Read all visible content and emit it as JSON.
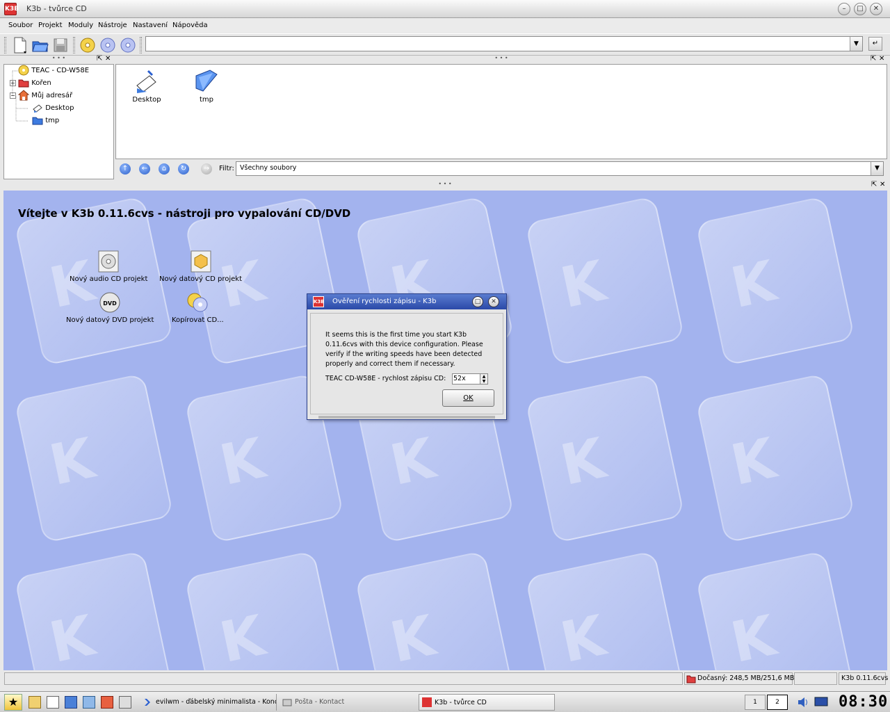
{
  "window": {
    "title": "K3b - tvůrce CD",
    "logo": "K3B"
  },
  "menu": [
    {
      "label": "Soubor"
    },
    {
      "label": "Projekt"
    },
    {
      "label": "Moduly"
    },
    {
      "label": "Nástroje"
    },
    {
      "label": "Nastavení"
    },
    {
      "label": "Nápověda"
    }
  ],
  "toolbar": {
    "url_value": ""
  },
  "tree": {
    "items": [
      {
        "label": "TEAC - CD-W58E",
        "icon": "cd-drive-icon"
      },
      {
        "label": "Kořen",
        "icon": "folder-red-icon"
      },
      {
        "label": "Můj adresář",
        "icon": "home-icon"
      },
      {
        "label": "Desktop",
        "icon": "desktop-icon"
      },
      {
        "label": "tmp",
        "icon": "folder-blue-icon"
      }
    ]
  },
  "files": {
    "items": [
      {
        "label": "Desktop"
      },
      {
        "label": "tmp"
      }
    ]
  },
  "filter": {
    "label": "Filtr:",
    "value": "Všechny soubory"
  },
  "welcome": {
    "title": "Vítejte v K3b 0.11.6cvs - nástroji pro vypalování CD/DVD",
    "actions": [
      {
        "label": "Nový audio CD projekt"
      },
      {
        "label": "Nový datový CD projekt"
      },
      {
        "label": "Nový datový DVD projekt"
      },
      {
        "label": "Kopírovat CD..."
      }
    ],
    "dvd_icon_text": "DVD"
  },
  "dialog": {
    "title": "Ověření rychlosti zápisu - K3b",
    "message": "It seems this is the first time you start K3b 0.11.6cvs with this device configuration. Please verify if the writing speeds have been detected properly and correct them if necessary.",
    "speed_label": "TEAC CD-W58E - rychlost zápisu CD:",
    "speed_value": "52x",
    "ok_label": "OK"
  },
  "status": {
    "temp": "Dočasný: 248,5 MB/251,6 MB",
    "version": "K3b 0.11.6cvs"
  },
  "taskbar": {
    "tasks": [
      {
        "label": "evilwm - ďábelský minimalista - Konq"
      },
      {
        "label": "Pošta - Kontact"
      },
      {
        "label": "K3b - tvůrce CD"
      }
    ],
    "desktops": [
      "1",
      "2"
    ],
    "clock": "08:30"
  }
}
